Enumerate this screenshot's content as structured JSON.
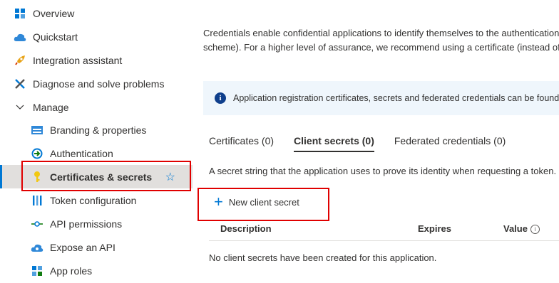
{
  "sidebar": {
    "overview": "Overview",
    "quickstart": "Quickstart",
    "integration": "Integration assistant",
    "diagnose": "Diagnose and solve problems",
    "manage": "Manage",
    "branding": "Branding & properties",
    "authentication": "Authentication",
    "certificates": "Certificates & secrets",
    "token": "Token configuration",
    "api_permissions": "API permissions",
    "expose_api": "Expose an API",
    "app_roles": "App roles"
  },
  "main": {
    "description_line1": "Credentials enable confidential applications to identify themselves to the authentication",
    "description_line2": "scheme). For a higher level of assurance, we recommend using a certificate (instead of a",
    "info_text": "Application registration certificates, secrets and federated credentials can be found in t",
    "tabs": [
      "Certificates (0)",
      "Client secrets (0)",
      "Federated credentials (0)"
    ],
    "secret_description": "A secret string that the application uses to prove its identity when requesting a token.",
    "new_button": "New client secret",
    "table_headers": [
      "Description",
      "Expires",
      "Value"
    ],
    "empty_message": "No client secrets have been created for this application."
  },
  "colors": {
    "accent": "#0078d4",
    "highlight": "#e00000",
    "info_bg": "#eff6fc"
  }
}
